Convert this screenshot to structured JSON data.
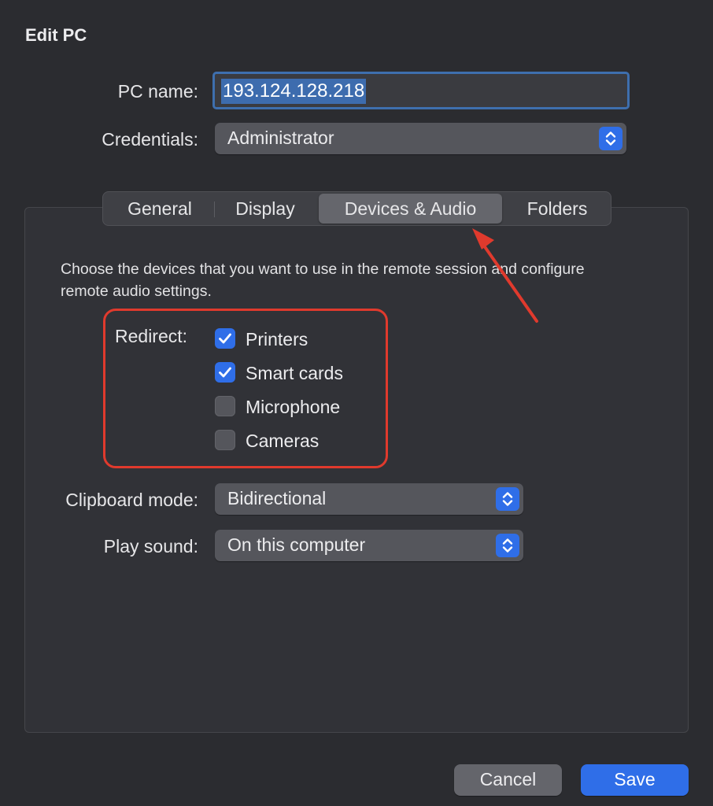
{
  "window": {
    "title": "Edit PC"
  },
  "form": {
    "pc_name_label": "PC name:",
    "pc_name_value": "193.124.128.218",
    "credentials_label": "Credentials:",
    "credentials_value": "Administrator"
  },
  "tabs": [
    {
      "label": "General",
      "selected": false
    },
    {
      "label": "Display",
      "selected": false
    },
    {
      "label": "Devices & Audio",
      "selected": true
    },
    {
      "label": "Folders",
      "selected": false
    }
  ],
  "devices": {
    "description": "Choose the devices that you want to use in the remote session and configure remote audio settings.",
    "redirect_label": "Redirect:",
    "items": [
      {
        "label": "Printers",
        "checked": true
      },
      {
        "label": "Smart cards",
        "checked": true
      },
      {
        "label": "Microphone",
        "checked": false
      },
      {
        "label": "Cameras",
        "checked": false
      }
    ],
    "clipboard_label": "Clipboard mode:",
    "clipboard_value": "Bidirectional",
    "sound_label": "Play sound:",
    "sound_value": "On this computer"
  },
  "buttons": {
    "cancel": "Cancel",
    "save": "Save"
  },
  "colors": {
    "accent": "#2f6ee8",
    "annotation": "#e03a2d",
    "background": "#2b2c30"
  },
  "icons": {
    "stepper": "chevron-up-down-icon",
    "check": "checkmark-icon",
    "annotation": "arrow-annotation-icon"
  }
}
